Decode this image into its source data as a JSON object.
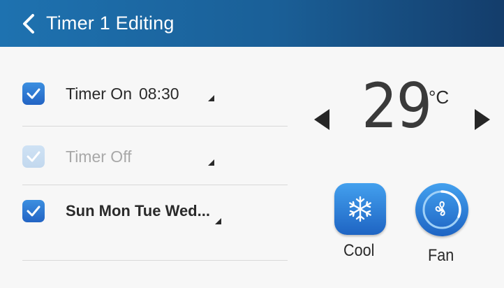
{
  "header": {
    "title": "Timer 1 Editing",
    "back_icon": "chevron-left-icon",
    "gradient": [
      "#1e72b0",
      "#143d6b"
    ]
  },
  "timer_on": {
    "checked": true,
    "label": "Timer On",
    "time": "08:30"
  },
  "timer_off": {
    "checked": true,
    "disabled": true,
    "label": "Timer Off"
  },
  "repeat_days": {
    "checked": true,
    "label": "Sun Mon Tue Wed..."
  },
  "temperature": {
    "value": "29",
    "unit": "°C"
  },
  "modes": [
    {
      "label": "Cool",
      "icon": "snowflake-icon"
    },
    {
      "label": "Fan",
      "icon": "fan-icon"
    }
  ],
  "colors": {
    "accent": "#2b79d4",
    "disabled_text": "#a8a8a8"
  }
}
